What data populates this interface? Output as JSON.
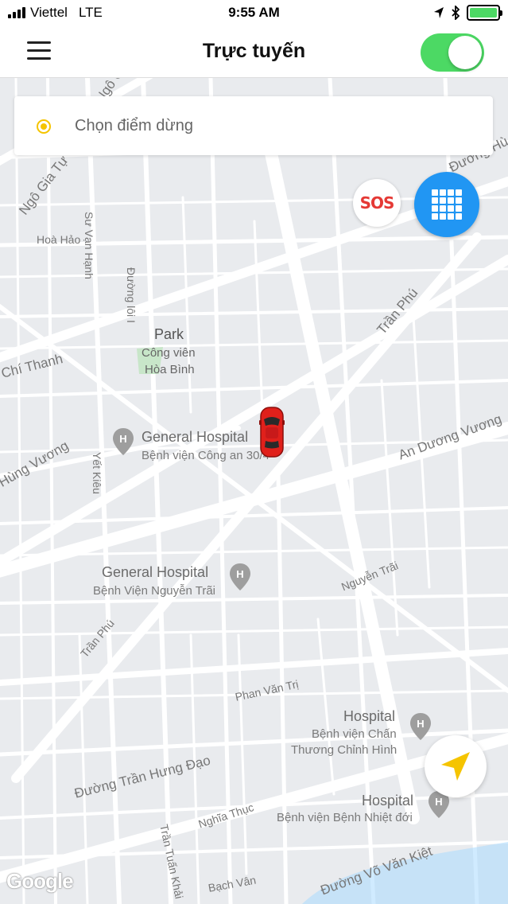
{
  "status_bar": {
    "carrier": "Viettel",
    "network": "LTE",
    "time": "9:55 AM"
  },
  "nav": {
    "title": "Trực tuyến",
    "online": true
  },
  "search": {
    "placeholder": "Chọn điểm dừng"
  },
  "buttons": {
    "sos": "SOS"
  },
  "map": {
    "streets": {
      "ngo_gia_tu_top": "Ngô Gia Tự",
      "ngo_gia_tu_left": "Ngô Gia Tự",
      "su_van_hanh": "Sư Vạn Hạnh",
      "hoa_hao": "Hoà Hảo",
      "duong_loi": "Đường lôi I",
      "chi_thanh": "Chí Thanh",
      "hung_vuong": "Hùng Vương",
      "yet_kieu": "Yết Kiêu",
      "tran_phu_top": "Trần Phú",
      "an_duong_vuong": "An Dương Vương",
      "nguyen_trai": "Nguyễn Trãi",
      "tran_phu_bottom": "Trần Phú",
      "phan_van_tri": "Phan Văn Trị",
      "tran_hung_dao": "Đường Trần Hưng Đạo",
      "nghia_thuc": "Nghĩa Thục",
      "tran_tuan_khai": "Trần Tuấn Khải",
      "bach_van": "Bạch Vân",
      "vo_van_kiet": "Đường Võ Văn Kiệt",
      "duong_hu": "Đường Hù"
    },
    "places": {
      "park_title": "Park",
      "park_sub_1": "Công viên",
      "park_sub_2": "Hòa Bình",
      "gh1_title": "General Hospital",
      "gh1_sub": "Bệnh viện Công an 30/4",
      "gh2_title": "General Hospital",
      "gh2_sub": "Bệnh Viện Nguyễn Trãi",
      "h3_title": "Hospital",
      "h3_sub_1": "Bệnh viện Chấn",
      "h3_sub_2": "Thương Chỉnh Hình",
      "h4_title": "Hospital",
      "h4_sub": "Bệnh viện Bệnh Nhiệt đới"
    },
    "attribution": "Google"
  },
  "colors": {
    "toggle_on": "#4cd964",
    "grid_button": "#2196f3",
    "sos": "#e53935",
    "pin_dot": "#f5c400",
    "car": "#e0201b",
    "locate_arrow": "#f5c400"
  }
}
